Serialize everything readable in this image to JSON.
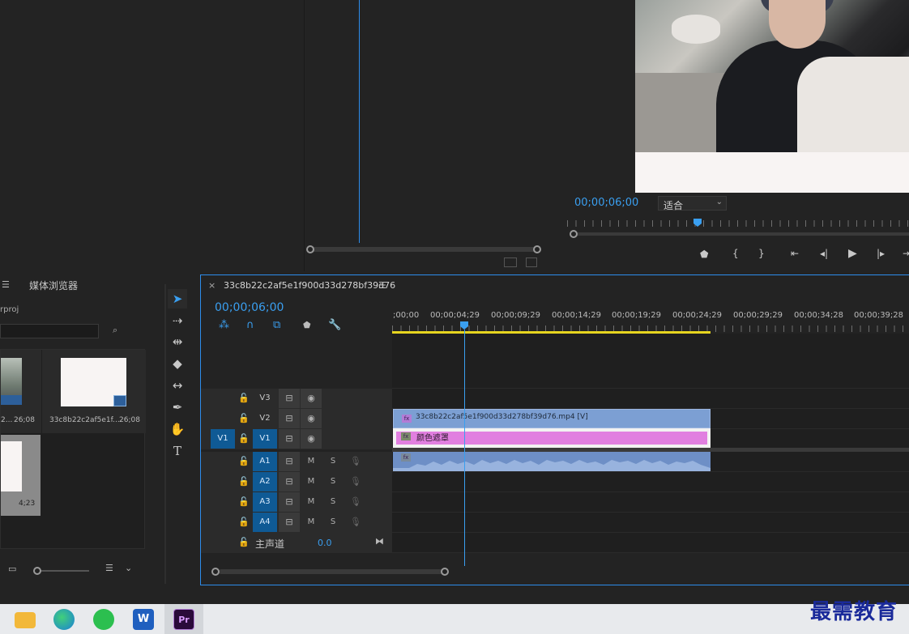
{
  "program_monitor": {
    "timecode": "00;00;06;00",
    "fit_label": "适合"
  },
  "project_panel": {
    "tab_media_browser": "媒体浏览器",
    "project_name_partial": "rproj",
    "items": [
      {
        "name": "2...",
        "duration": "26;08"
      },
      {
        "name": "33c8b22c2af5e1f...",
        "duration": "26;08"
      },
      {
        "name": "",
        "duration": "4;23"
      }
    ]
  },
  "timeline": {
    "close_glyph": "×",
    "sequence_name": "33c8b22c2af5e1f900d33d278bf39d76",
    "timecode": "00;00;06;00",
    "ruler_labels": [
      ";00;00",
      "00;00;04;29",
      "00;00;09;29",
      "00;00;14;29",
      "00;00;19;29",
      "00;00;24;29",
      "00;00;29;29",
      "00;00;34;28",
      "00;00;39;28"
    ],
    "tracks": {
      "v3": "V3",
      "v2": "V2",
      "v1": "V1",
      "v1_source": "V1",
      "a1": "A1",
      "a2": "A2",
      "a3": "A3",
      "a4": "A4",
      "mute": "M",
      "solo": "S",
      "master_label": "主声道",
      "master_value": "0.0"
    },
    "clip_video_label": "33c8b22c2af5e1f900d33d278bf39d76.mp4 [V]",
    "clip_matte_label": "颜色遮罩",
    "fx_label": "fx"
  },
  "watermark": "最需教育",
  "taskbar_icons": [
    "file-explorer-icon",
    "edge-icon",
    "wechat-icon",
    "word-icon",
    "premiere-icon"
  ],
  "taskbar_labels": {
    "word": "W",
    "premiere": "Pr"
  },
  "colors": {
    "accent": "#2d8ceb",
    "timecode": "#3a9ff0",
    "track_blue": "#0f5a95",
    "clip_video": "#7c9fd3",
    "clip_matte": "#e17fe0",
    "workarea": "#e7d51f"
  }
}
